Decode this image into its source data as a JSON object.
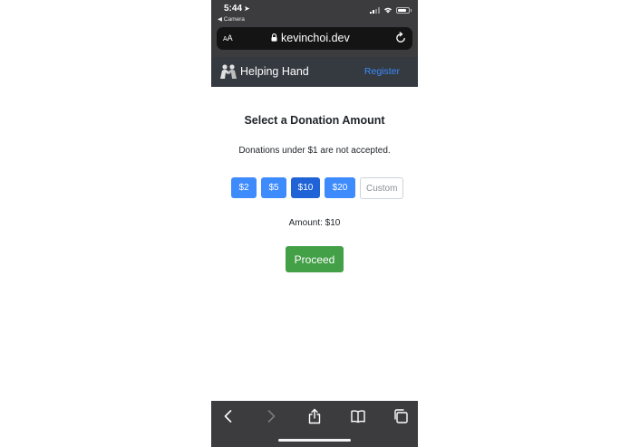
{
  "status_bar": {
    "time": "5:44",
    "location_arrow": "➤",
    "back_app": "◀ Camera"
  },
  "browser": {
    "aa_label_small": "A",
    "aa_label_large": "A",
    "url": "kevinchoi.dev"
  },
  "navbar": {
    "brand": "Helping Hand",
    "register": "Register"
  },
  "page": {
    "heading": "Select a Donation Amount",
    "notice": "Donations under $1 are not accepted.",
    "amounts": [
      "$2",
      "$5",
      "$10",
      "$20"
    ],
    "selected_amount": "$10",
    "custom_placeholder": "Custom",
    "amount_display": "Amount: $10",
    "proceed": "Proceed"
  },
  "colors": {
    "primary": "#3d8bfd",
    "primary_active": "#1f63d6",
    "success": "#43a047",
    "navbar": "#343a40"
  },
  "icons": {
    "toolbar": [
      "back-icon",
      "forward-icon",
      "share-icon",
      "bookmarks-icon",
      "tabs-icon"
    ]
  }
}
